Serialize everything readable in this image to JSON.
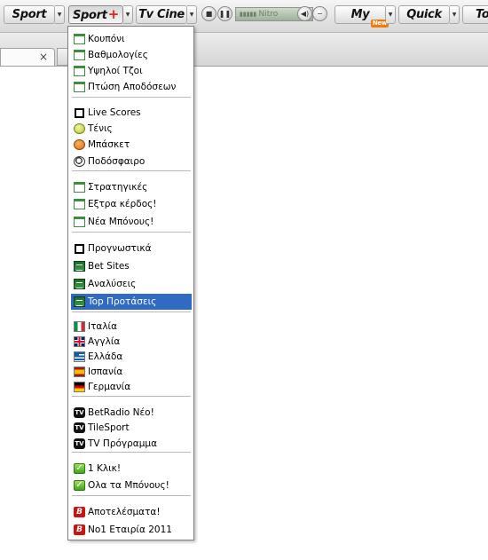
{
  "toolbar": {
    "sport_label": "Sport",
    "sportplus_label": "Sport",
    "sportplus_plus": "+",
    "tvcine_label": "Tv Cine",
    "player_station": "Nitro",
    "my_label": "My",
    "my_badge": "New",
    "quick_label": "Quick",
    "to_label": "To"
  },
  "tab": {
    "close_glyph": "×"
  },
  "menu": {
    "items": [
      {
        "label": "Κουπόνι",
        "icon": "calendar-icon"
      },
      {
        "label": "Βαθμολογίες",
        "icon": "calendar-icon"
      },
      {
        "label": "Υψηλοί Τζοι",
        "icon": "calendar-icon"
      },
      {
        "label": "Πτώση Αποδόσεων",
        "icon": "calendar-icon"
      },
      {
        "label": "Live Scores",
        "icon": "box-icon"
      },
      {
        "label": "Τένις",
        "icon": "tennis-ball-icon"
      },
      {
        "label": "Μπάσκετ",
        "icon": "basketball-icon"
      },
      {
        "label": "Ποδόσφαιρο",
        "icon": "soccer-ball-icon"
      },
      {
        "label": "Στρατηγικές",
        "icon": "calendar-icon"
      },
      {
        "label": "Εξτρα κέρδος!",
        "icon": "calendar-icon"
      },
      {
        "label": "Νέα Μπόνους!",
        "icon": "calendar-icon"
      },
      {
        "label": "Προγνωστικά",
        "icon": "box-icon"
      },
      {
        "label": "Bet Sites",
        "icon": "spreadsheet-icon"
      },
      {
        "label": "Αναλύσεις",
        "icon": "spreadsheet-icon"
      },
      {
        "label": "Top Προτάσεις",
        "icon": "spreadsheet-icon"
      },
      {
        "label": "Ιταλία",
        "icon": "italy-flag-icon"
      },
      {
        "label": "Αγγλία",
        "icon": "uk-flag-icon"
      },
      {
        "label": "Ελλάδα",
        "icon": "greece-flag-icon"
      },
      {
        "label": "Ισπανία",
        "icon": "spain-flag-icon"
      },
      {
        "label": "Γερμανία",
        "icon": "germany-flag-icon"
      },
      {
        "label": "BetRadio Νέο!",
        "icon": "tv-icon"
      },
      {
        "label": "TileSport",
        "icon": "tv-icon"
      },
      {
        "label": "TV Πρόγραμμα",
        "icon": "tv-icon"
      },
      {
        "label": "1 Κλικ!",
        "icon": "checkmark-icon"
      },
      {
        "label": "Ολα τα Μπόνους!",
        "icon": "checkmark-icon"
      },
      {
        "label": "Αποτελέσματα!",
        "icon": "b-logo-icon"
      },
      {
        "label": "Νο1 Εταιρία 2011",
        "icon": "b-logo-icon"
      }
    ],
    "icon_glyphs": {
      "tv": "TV",
      "check": "✓",
      "b": "B"
    },
    "selected_index": 14
  },
  "colors": {
    "selection": "#316ac5",
    "menu_border": "#7f7f7f",
    "plus_red": "#e2241b"
  }
}
